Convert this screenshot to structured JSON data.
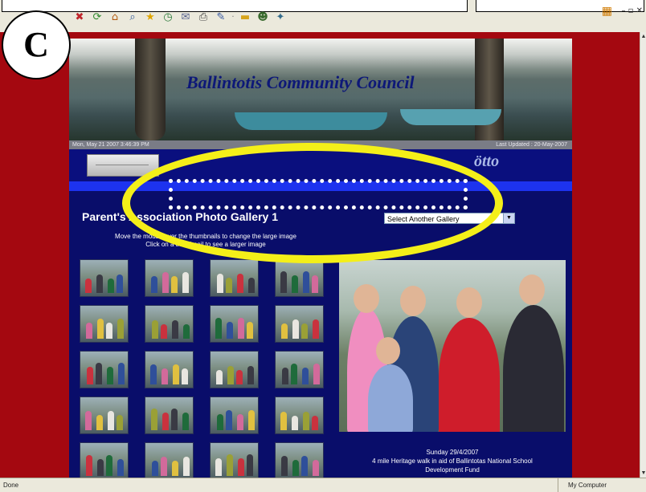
{
  "label_badge": "C",
  "browser": {
    "toolbar_icons": [
      "stop-icon",
      "refresh-icon",
      "home-icon",
      "search-icon",
      "favorites-icon",
      "history-icon",
      "mail-icon",
      "print-icon",
      "edit-icon",
      "folder-icon",
      "messenger-icon",
      "extra-icon"
    ],
    "status": {
      "left": "Done",
      "zone": "My Computer"
    }
  },
  "site": {
    "title": "Ballintotis Community Council",
    "infobar": {
      "datetime": "Mon, May 21 2007 3:46:39 PM",
      "updated": "Last Updated : 20-May-2007"
    },
    "logo_text": "ötto"
  },
  "gallery": {
    "title": "Parent's Association Photo Gallery 1",
    "select_value": "Select Another Gallery",
    "instructions": [
      "Move the mouse over the thumbnails to change the large image",
      "Click on a thumbnail to see a larger image"
    ],
    "thumbnails": [
      1,
      2,
      3,
      4,
      5,
      6,
      7,
      8,
      9,
      10,
      11,
      12,
      13,
      14,
      15,
      16,
      17,
      18,
      19,
      20
    ],
    "caption": [
      "Sunday 29/4/2007",
      "4 mile Heritage walk in aid of Ballintotas National School",
      "Development Fund"
    ]
  },
  "colors": {
    "page_bg": "#a40810",
    "content_bg": "#090d6a",
    "annotation_ring": "#f4ef19"
  }
}
